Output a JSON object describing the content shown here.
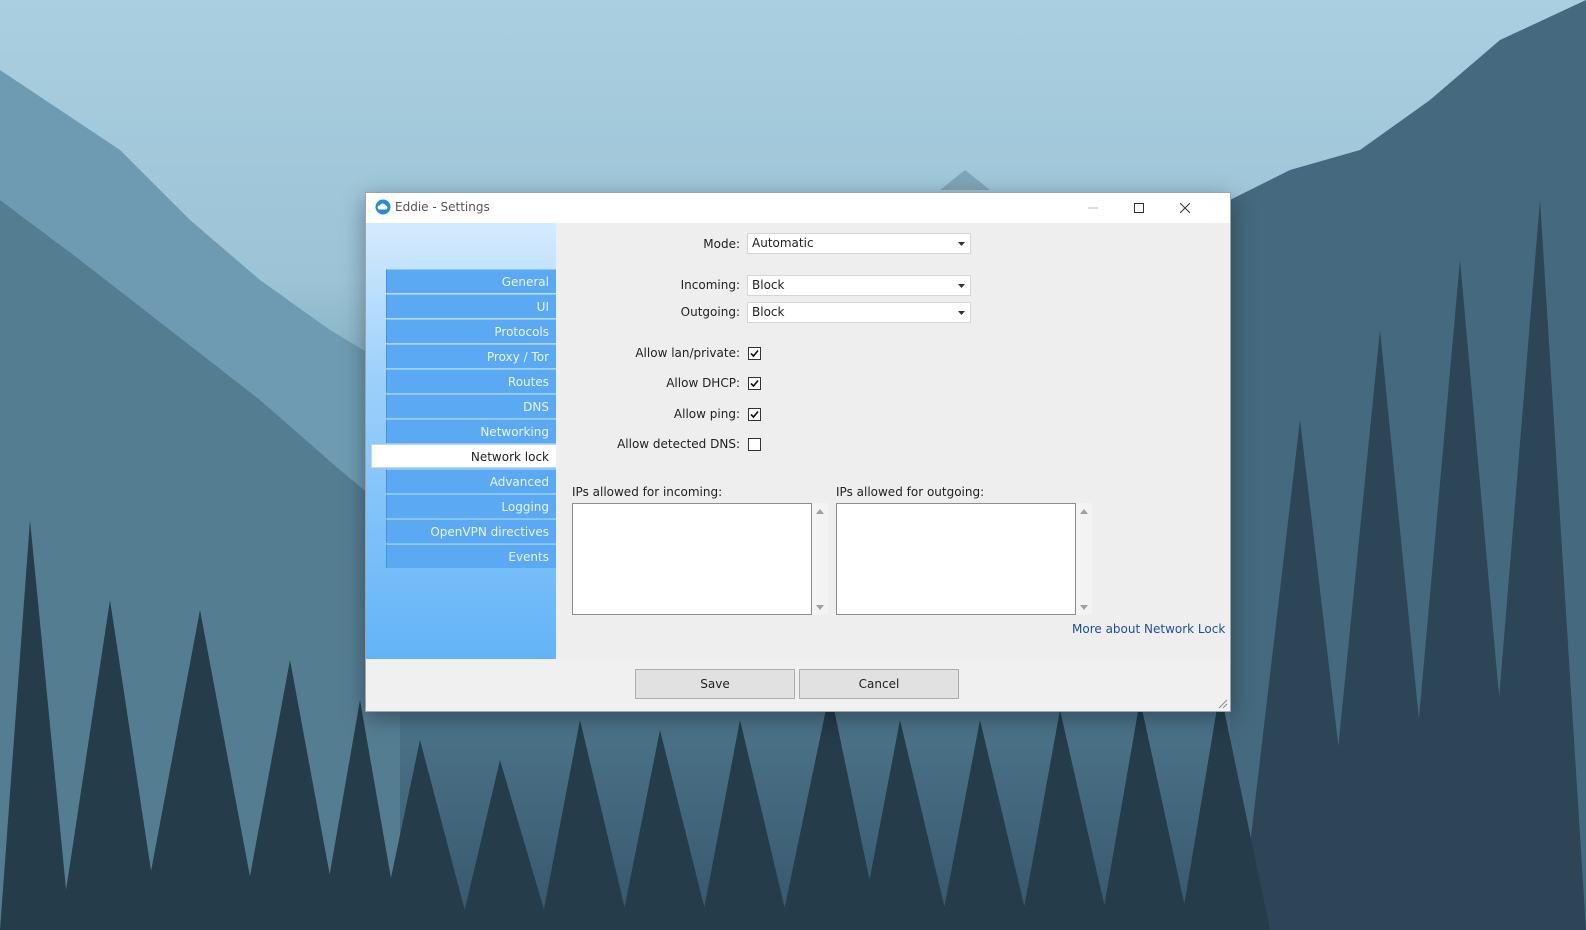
{
  "window": {
    "title": "Eddie - Settings",
    "icon": "eddie-cloud-icon"
  },
  "titlebar_buttons": {
    "minimize_icon": "minimize-icon",
    "maximize_icon": "maximize-icon",
    "close_icon": "close-icon"
  },
  "sidebar": {
    "items": [
      {
        "label": "General"
      },
      {
        "label": "UI"
      },
      {
        "label": "Protocols"
      },
      {
        "label": "Proxy / Tor"
      },
      {
        "label": "Routes"
      },
      {
        "label": "DNS"
      },
      {
        "label": "Networking"
      },
      {
        "label": "Network lock",
        "active": true
      },
      {
        "label": "Advanced"
      },
      {
        "label": "Logging"
      },
      {
        "label": "OpenVPN directives"
      },
      {
        "label": "Events"
      }
    ]
  },
  "form": {
    "mode": {
      "label": "Mode:",
      "value": "Automatic"
    },
    "incoming": {
      "label": "Incoming:",
      "value": "Block"
    },
    "outgoing": {
      "label": "Outgoing:",
      "value": "Block"
    },
    "allow_lan": {
      "label": "Allow lan/private:",
      "checked": true
    },
    "allow_dhcp": {
      "label": "Allow DHCP:",
      "checked": true
    },
    "allow_ping": {
      "label": "Allow ping:",
      "checked": true
    },
    "allow_dns": {
      "label": "Allow detected DNS:",
      "checked": false
    },
    "ips_incoming": {
      "label": "IPs allowed for incoming:",
      "value": ""
    },
    "ips_outgoing": {
      "label": "IPs allowed for outgoing:",
      "value": ""
    },
    "more_link": "More about Network Lock"
  },
  "footer": {
    "save_label": "Save",
    "cancel_label": "Cancel"
  },
  "colors": {
    "sidebar_item": "#5aa9f2",
    "link": "#1f4e9c",
    "window_bg": "#f0f0f0"
  }
}
